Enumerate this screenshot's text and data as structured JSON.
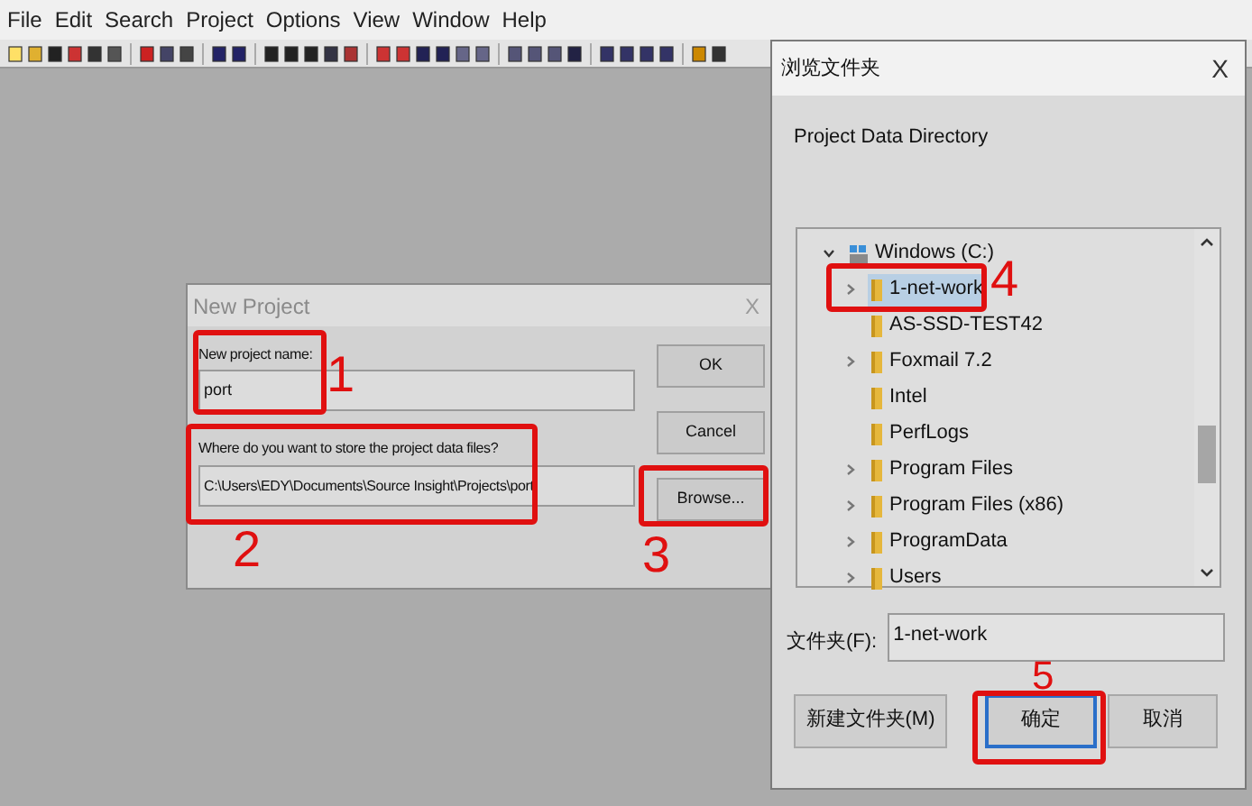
{
  "menu_bar": [
    "File",
    "Edit",
    "Search",
    "Project",
    "Options",
    "View",
    "Window",
    "Help"
  ],
  "new_project_dialog": {
    "title": "New Project",
    "close": "X",
    "name_label": "New project name:",
    "name_value": "port",
    "location_label": "Where do you want to store the project data files?",
    "location_value": "C:\\Users\\EDY\\Documents\\Source Insight\\Projects\\port",
    "buttons": [
      "OK",
      "Cancel",
      "Browse..."
    ]
  },
  "browse_dialog": {
    "title": "浏览文件夹",
    "close": "X",
    "description": "Project Data Directory",
    "tree": [
      {
        "label": "Windows (C:)",
        "expanded": true,
        "selected": false,
        "children": [
          {
            "label": "1-net-work",
            "expandable": true,
            "selected": true
          },
          {
            "label": "AS-SSD-TEST42",
            "expandable": false,
            "selected": false
          },
          {
            "label": "Foxmail 7.2",
            "expandable": true,
            "selected": false
          },
          {
            "label": "Intel",
            "expandable": false,
            "selected": false
          },
          {
            "label": "PerfLogs",
            "expandable": false,
            "selected": false
          },
          {
            "label": "Program Files",
            "expandable": true,
            "selected": false
          },
          {
            "label": "Program Files (x86)",
            "expandable": true,
            "selected": false
          },
          {
            "label": "ProgramData",
            "expandable": true,
            "selected": false
          },
          {
            "label": "Users",
            "expandable": true,
            "selected": false
          }
        ]
      }
    ],
    "folder_label": "文件夹(F):",
    "folder_value": "1-net-work",
    "buttons": [
      {
        "label": "新建文件夹(M)",
        "focused": false
      },
      {
        "label": "确定",
        "focused": true
      },
      {
        "label": "取消",
        "focused": false
      }
    ]
  },
  "annotations": [
    {
      "label": "1"
    },
    {
      "label": "2"
    },
    {
      "label": "3"
    },
    {
      "label": "4"
    },
    {
      "label": "5"
    }
  ]
}
